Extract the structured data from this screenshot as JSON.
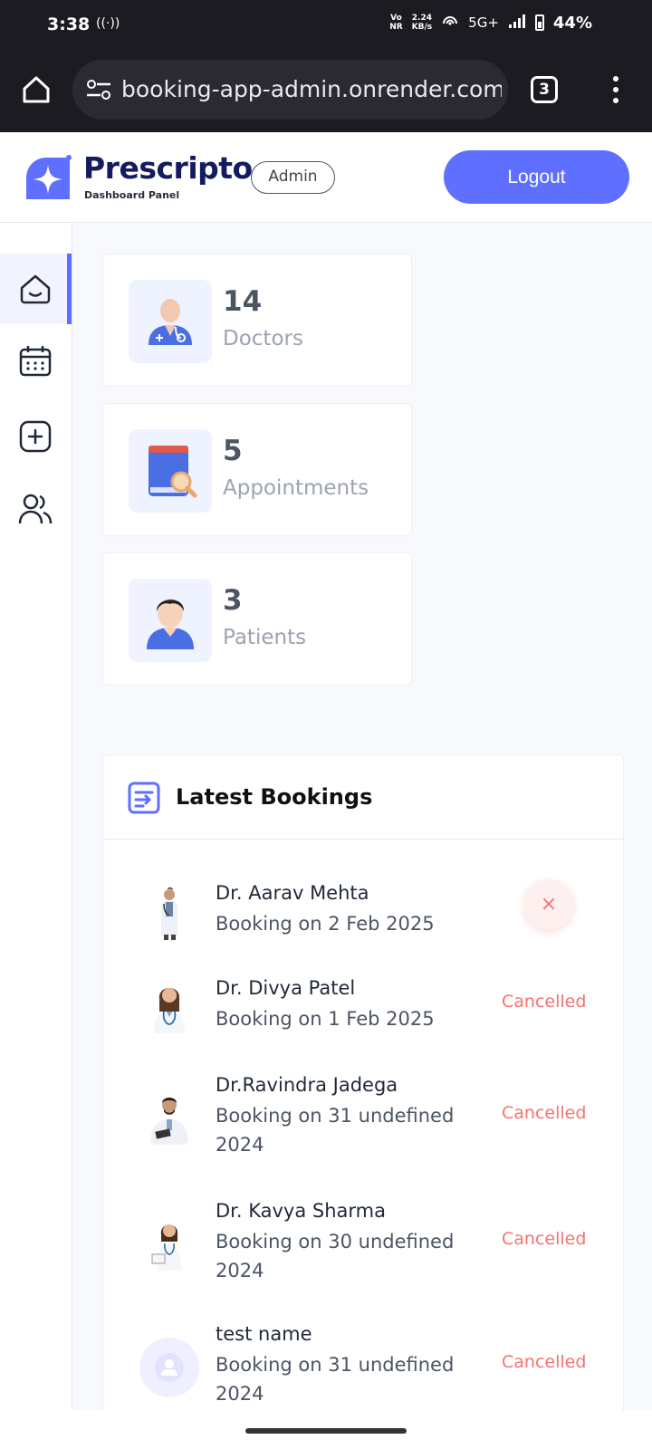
{
  "status_bar": {
    "time": "3:38",
    "cast_glyph": "((·))",
    "net_top": "Vo\nNR",
    "speed": "2.24\nKB/s",
    "network": "5G+",
    "battery": "44%"
  },
  "browser": {
    "url": "booking-app-admin.onrender.com",
    "tab_count": "3"
  },
  "header": {
    "brand": "Prescripto",
    "subtitle": "Dashboard Panel",
    "role_badge": "Admin",
    "logout_label": "Logout",
    "accent": "#5f6fff"
  },
  "sidebar": {
    "items": [
      {
        "icon": "home-icon",
        "active": true
      },
      {
        "icon": "calendar-icon",
        "active": false
      },
      {
        "icon": "add-doctor-icon",
        "active": false
      },
      {
        "icon": "people-icon",
        "active": false
      }
    ]
  },
  "stats": [
    {
      "count": "14",
      "label": "Doctors",
      "icon": "doctor-icon"
    },
    {
      "count": "5",
      "label": "Appointments",
      "icon": "appointment-book-icon"
    },
    {
      "count": "3",
      "label": "Patients",
      "icon": "patient-icon"
    }
  ],
  "latest_bookings": {
    "title": "Latest Bookings",
    "rows": [
      {
        "name": "Dr. Aarav Mehta",
        "date": "Booking on 2 Feb 2025",
        "status": "",
        "cancel_icon": "×"
      },
      {
        "name": "Dr. Divya Patel",
        "date": "Booking on 1 Feb 2025",
        "status": "Cancelled"
      },
      {
        "name": "Dr.Ravindra Jadega",
        "date": "Booking on 31 undefined 2024",
        "status": "Cancelled"
      },
      {
        "name": "Dr. Kavya Sharma",
        "date": "Booking on 30 undefined 2024",
        "status": "Cancelled"
      },
      {
        "name": "test name",
        "date": "Booking on 31 undefined 2024",
        "status": "Cancelled"
      }
    ]
  }
}
